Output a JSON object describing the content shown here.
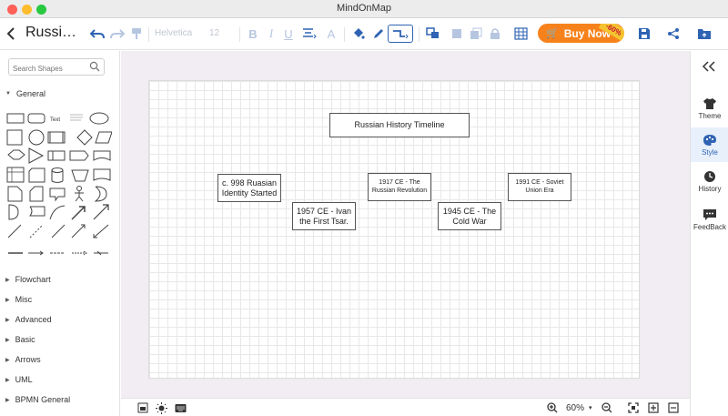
{
  "window": {
    "title": "MindOnMap"
  },
  "toolbar": {
    "doc_title": "Russi…",
    "font_name": "Helvetica",
    "font_size": "12",
    "buy_now": "Buy Now",
    "discount": "-60%"
  },
  "left_panel": {
    "search_placeholder": "Search Shapes",
    "general_label": "General",
    "text_shape_label": "Text",
    "categories": [
      "Flowchart",
      "Misc",
      "Advanced",
      "Basic",
      "Arrows",
      "UML",
      "BPMN General"
    ]
  },
  "canvas": {
    "nodes": [
      {
        "text": "Russian History Timeline"
      },
      {
        "text": "c. 998 Ruasian Identity Started"
      },
      {
        "text": "1957 CE - Ivan the First Tsar."
      },
      {
        "text": "1917 CE - The Russian Revolution"
      },
      {
        "text": "1945 CE - The Cold War"
      },
      {
        "text": "1991 CE - Soviet Union Era"
      }
    ]
  },
  "bottom_bar": {
    "zoom": "60%"
  },
  "right_panel": {
    "items": [
      {
        "label": "Theme",
        "icon": "shirt-icon"
      },
      {
        "label": "Style",
        "icon": "palette-icon",
        "active": true
      },
      {
        "label": "History",
        "icon": "clock-icon"
      },
      {
        "label": "FeedBack",
        "icon": "feedback-icon"
      }
    ]
  },
  "colors": {
    "accent": "#2f63b3",
    "buy_button": "#f7821b",
    "canvas_bg": "#f1edf2"
  }
}
